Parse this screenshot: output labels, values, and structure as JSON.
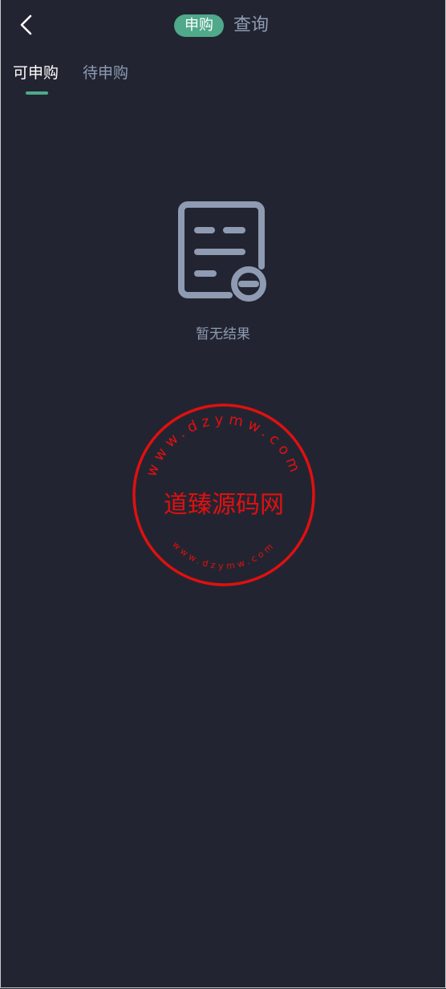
{
  "header": {
    "back_icon": "chevron-left-icon",
    "segment_active": "申购",
    "segment_inactive": "查询"
  },
  "tabs": [
    {
      "label": "可申购",
      "active": true
    },
    {
      "label": "待申购",
      "active": false
    }
  ],
  "empty_state": {
    "icon": "document-minus-icon",
    "text": "暂无结果"
  },
  "watermark": {
    "center_text": "道臻源码网",
    "upper_ring_text": "www.dzymw.com",
    "lower_ring_text": "www.dzymw.com",
    "color": "#e01010"
  },
  "colors": {
    "background": "#222531",
    "accent": "#4fa98a",
    "muted_text": "#8e9bb2",
    "icon_gray": "#8e9bb2"
  }
}
